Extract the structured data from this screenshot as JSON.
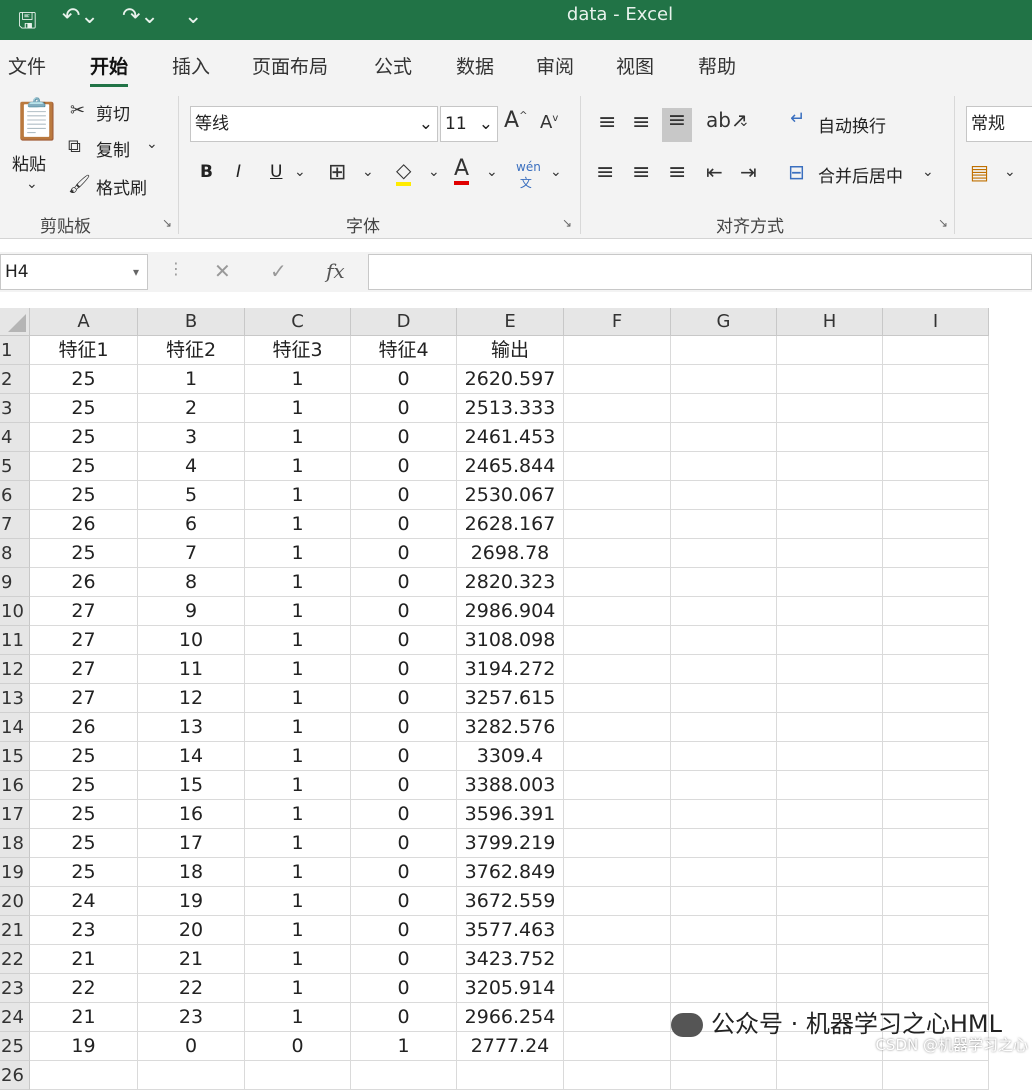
{
  "titlebar": {
    "title": "data  -  Excel"
  },
  "tabs": [
    "文件",
    "开始",
    "插入",
    "页面布局",
    "公式",
    "数据",
    "审阅",
    "视图",
    "帮助"
  ],
  "active_tab": "开始",
  "clipboard": {
    "paste": "粘贴",
    "cut": "剪切",
    "copy": "复制",
    "format_painter": "格式刷",
    "group": "剪贴板"
  },
  "font": {
    "name": "等线",
    "size": "11",
    "bold": "B",
    "italic": "I",
    "underline": "U",
    "group": "字体"
  },
  "alignment": {
    "wrap": "自动换行",
    "merge": "合并后居中",
    "group": "对齐方式"
  },
  "number": {
    "format": "常规"
  },
  "formula_bar": {
    "name_box": "H4",
    "fx": "fx",
    "value": ""
  },
  "columns": [
    "A",
    "B",
    "C",
    "D",
    "E",
    "F",
    "G",
    "H",
    "I"
  ],
  "rows": [
    [
      "特征1",
      "特征2",
      "特征3",
      "特征4",
      "输出"
    ],
    [
      "25",
      "1",
      "1",
      "0",
      "2620.597"
    ],
    [
      "25",
      "2",
      "1",
      "0",
      "2513.333"
    ],
    [
      "25",
      "3",
      "1",
      "0",
      "2461.453"
    ],
    [
      "25",
      "4",
      "1",
      "0",
      "2465.844"
    ],
    [
      "25",
      "5",
      "1",
      "0",
      "2530.067"
    ],
    [
      "26",
      "6",
      "1",
      "0",
      "2628.167"
    ],
    [
      "25",
      "7",
      "1",
      "0",
      "2698.78"
    ],
    [
      "26",
      "8",
      "1",
      "0",
      "2820.323"
    ],
    [
      "27",
      "9",
      "1",
      "0",
      "2986.904"
    ],
    [
      "27",
      "10",
      "1",
      "0",
      "3108.098"
    ],
    [
      "27",
      "11",
      "1",
      "0",
      "3194.272"
    ],
    [
      "27",
      "12",
      "1",
      "0",
      "3257.615"
    ],
    [
      "26",
      "13",
      "1",
      "0",
      "3282.576"
    ],
    [
      "25",
      "14",
      "1",
      "0",
      "3309.4"
    ],
    [
      "25",
      "15",
      "1",
      "0",
      "3388.003"
    ],
    [
      "25",
      "16",
      "1",
      "0",
      "3596.391"
    ],
    [
      "25",
      "17",
      "1",
      "0",
      "3799.219"
    ],
    [
      "25",
      "18",
      "1",
      "0",
      "3762.849"
    ],
    [
      "24",
      "19",
      "1",
      "0",
      "3672.559"
    ],
    [
      "23",
      "20",
      "1",
      "0",
      "3577.463"
    ],
    [
      "21",
      "21",
      "1",
      "0",
      "3423.752"
    ],
    [
      "22",
      "22",
      "1",
      "0",
      "3205.914"
    ],
    [
      "21",
      "23",
      "1",
      "0",
      "2966.254"
    ],
    [
      "19",
      "0",
      "0",
      "1",
      "2777.24"
    ]
  ],
  "watermark": {
    "text": "公众号 · 机器学习之心HML",
    "csdn": "CSDN @机器学习之心"
  },
  "colors": {
    "excel_green": "#217346",
    "ribbon_bg": "#f3f3f3",
    "header_bg": "#e6e6e6"
  }
}
